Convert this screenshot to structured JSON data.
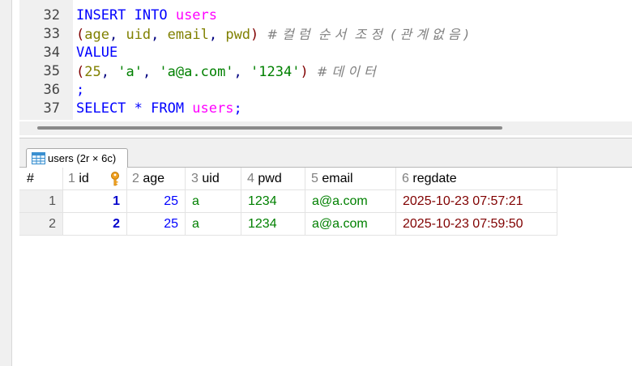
{
  "editor": {
    "lines": [
      {
        "num": "32",
        "tokens": [
          {
            "t": "INSERT INTO ",
            "c": "kw"
          },
          {
            "t": "users",
            "c": "tbl"
          }
        ]
      },
      {
        "num": "33",
        "tokens": [
          {
            "t": "(",
            "c": "paren"
          },
          {
            "t": "age",
            "c": "col"
          },
          {
            "t": ", ",
            "c": "plain"
          },
          {
            "t": "uid",
            "c": "col"
          },
          {
            "t": ", ",
            "c": "plain"
          },
          {
            "t": "email",
            "c": "col"
          },
          {
            "t": ", ",
            "c": "plain"
          },
          {
            "t": "pwd",
            "c": "col"
          },
          {
            "t": ") ",
            "c": "paren"
          },
          {
            "t": "# 컬 럼  순 서  조 정  ( 관 계 없 음 )",
            "c": "cmt"
          }
        ]
      },
      {
        "num": "34",
        "tokens": [
          {
            "t": "VALUE",
            "c": "kw"
          }
        ]
      },
      {
        "num": "35",
        "tokens": [
          {
            "t": "(",
            "c": "paren"
          },
          {
            "t": "25",
            "c": "num"
          },
          {
            "t": ", ",
            "c": "plain"
          },
          {
            "t": "'a'",
            "c": "str"
          },
          {
            "t": ", ",
            "c": "plain"
          },
          {
            "t": "'a@a.com'",
            "c": "str"
          },
          {
            "t": ", ",
            "c": "plain"
          },
          {
            "t": "'1234'",
            "c": "str"
          },
          {
            "t": ") ",
            "c": "paren"
          },
          {
            "t": "# 데 이 터",
            "c": "cmt"
          }
        ]
      },
      {
        "num": "36",
        "tokens": [
          {
            "t": ";",
            "c": "kw"
          }
        ]
      },
      {
        "num": "37",
        "tokens": [
          {
            "t": "SELECT * FROM ",
            "c": "kw"
          },
          {
            "t": "users",
            "c": "tbl"
          },
          {
            "t": ";",
            "c": "kw"
          }
        ]
      }
    ]
  },
  "result_tab": {
    "label": "users (2r × 6c)"
  },
  "grid": {
    "row_header": "#",
    "columns": [
      {
        "num": "1",
        "name": "id",
        "key": true
      },
      {
        "num": "2",
        "name": "age"
      },
      {
        "num": "3",
        "name": "uid"
      },
      {
        "num": "4",
        "name": "pwd"
      },
      {
        "num": "5",
        "name": "email"
      },
      {
        "num": "6",
        "name": "regdate"
      }
    ],
    "rows": [
      {
        "n": "1",
        "id": "1",
        "age": "25",
        "uid": "a",
        "pwd": "1234",
        "email": "a@a.com",
        "regdate": "2025-10-23 07:57:21"
      },
      {
        "n": "2",
        "id": "2",
        "age": "25",
        "uid": "a",
        "pwd": "1234",
        "email": "a@a.com",
        "regdate": "2025-10-23 07:59:50"
      }
    ]
  },
  "colors": {
    "keyword": "#0000ff",
    "table": "#ff00ff",
    "column": "#808000",
    "string": "#008000",
    "comment": "#808080",
    "date": "#800000"
  }
}
